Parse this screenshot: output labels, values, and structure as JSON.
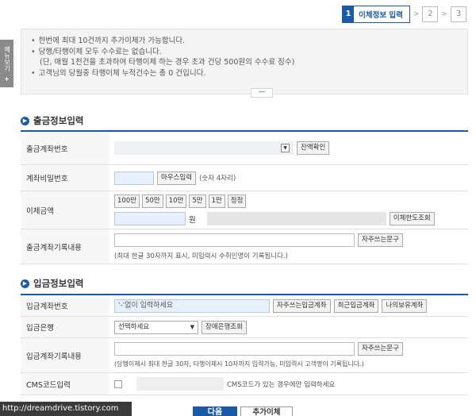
{
  "steps": {
    "active_num": "1",
    "active_label": "이체정보 입력",
    "step2": "2",
    "step3": "3",
    "arrow": ">"
  },
  "side_menu": {
    "label": "메뉴보기",
    "plus": "+"
  },
  "notice": {
    "bullet": "•",
    "lines": [
      "한번에 최대 10건까지 추가이체가 가능합니다.",
      "당행/타행이체 모두 수수료는 없습니다.",
      "(단, 매월 1천건을 초과하여 타행이체 하는 경우 초과 건당 500원의 수수료 징수)",
      "고객님의 당월중 타행이체 누적건수는 총 0 건입니다."
    ],
    "toggle": "—"
  },
  "withdraw": {
    "title": "출금정보입력",
    "account_label": "출금계좌번호",
    "balance_button": "잔액확인",
    "password_label": "계좌비밀번호",
    "mouse_input_button": "마우스입력",
    "password_hint": "(숫자 4자리)",
    "amount_label": "이체금액",
    "amount_buttons": [
      "100만",
      "50만",
      "10만",
      "5만",
      "1만",
      "정정"
    ],
    "amount_unit": "원",
    "limit_button": "이체한도조회",
    "memo_label": "출금계좌기록내용",
    "frequent_button": "자주쓰는문구",
    "memo_help": "(최대 한글 30자까지 표시, 미입력시 수취인명이 기록됩니다.)"
  },
  "deposit": {
    "title": "입금정보입력",
    "account_label": "입금계좌번호",
    "account_placeholder": "'-'없이 입력하세요",
    "frequent_account_button": "자주쓰는입금계좌",
    "recent_account_button": "최근입금계좌",
    "my_account_button": "나의보유계좌",
    "bank_label": "입금은행",
    "bank_select": "선택하세요",
    "bank_search_button": "장애은행조회",
    "memo_label": "입금계좌기록내용",
    "frequent_button": "자주쓰는문구",
    "memo_help": "(당행이체시 최대 한글 30자, 타행이체시 10자까지 입력가능, 미입력시 고객명이 기록됩니다.)",
    "cms_label": "CMS코드입력",
    "cms_help": "CMS코드가 있는 경우에만 입력하세요"
  },
  "actions": {
    "next": "다음",
    "add_transfer": "추가이체"
  },
  "watermark": "http://dreamdrive.tistory.com",
  "colors": {
    "accent": "#1b5aa8"
  },
  "icons": {
    "section": "arrow-circle-icon",
    "dropdown": "chevron-down-icon"
  }
}
